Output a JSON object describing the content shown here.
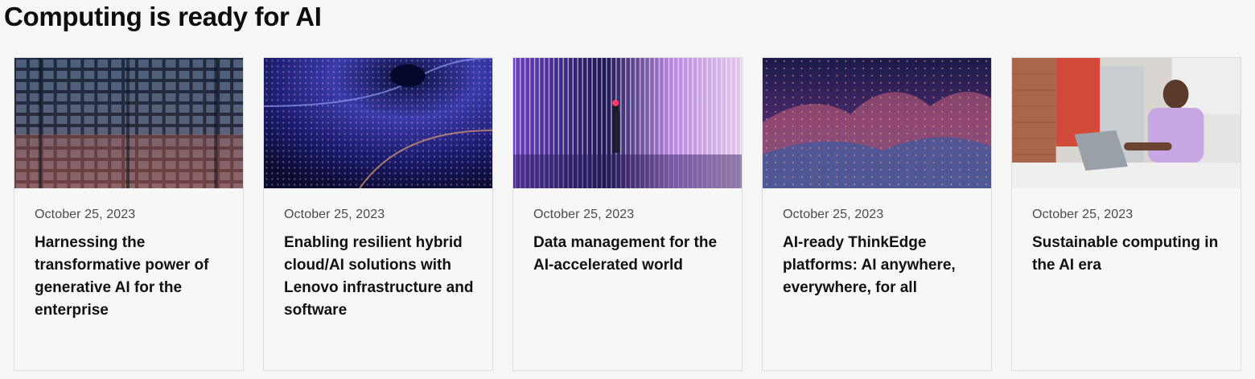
{
  "section": {
    "title": "Computing is ready for AI"
  },
  "cards": [
    {
      "date": "October 25, 2023",
      "title": "Harnessing the transformative power of generative AI for the enterprise",
      "image": "glass-office-tower-photo"
    },
    {
      "date": "October 25, 2023",
      "title": "Enabling resilient hybrid cloud/AI solutions with Lenovo infrastructure and software",
      "image": "digital-light-tunnel-photo"
    },
    {
      "date": "October 25, 2023",
      "title": "Data management for the AI-accelerated world",
      "image": "light-curtain-corridor-photo"
    },
    {
      "date": "October 25, 2023",
      "title": "AI-ready ThinkEdge platforms: AI anywhere, everywhere, for all",
      "image": "glowing-terrain-photo"
    },
    {
      "date": "October 25, 2023",
      "title": "Sustainable computing in the AI era",
      "image": "person-with-laptop-kitchen-photo"
    }
  ]
}
